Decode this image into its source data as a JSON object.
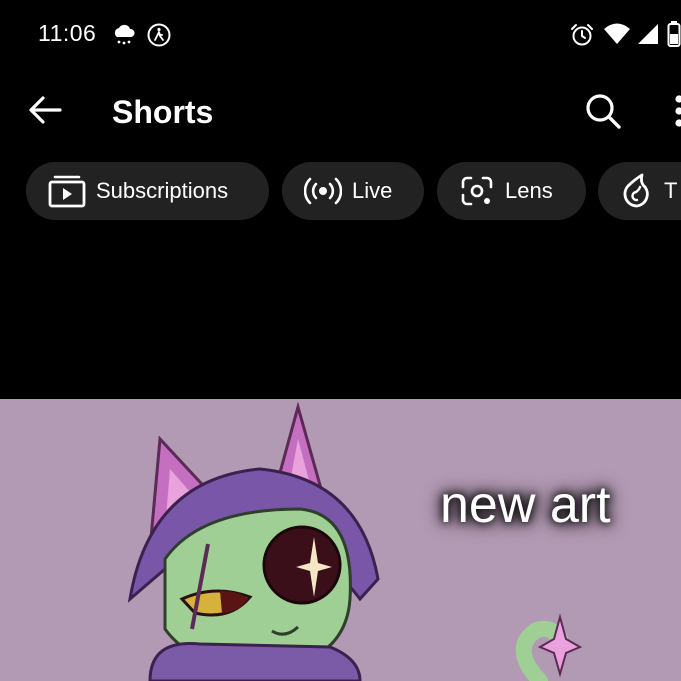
{
  "status_bar": {
    "time": "11:06",
    "left_icons": [
      "weather-rain-icon",
      "accessibility-icon"
    ],
    "right_icons": [
      "alarm-icon",
      "wifi-icon",
      "signal-icon",
      "battery-icon"
    ]
  },
  "app_bar": {
    "title": "Shorts",
    "back_icon": "arrow-left-icon",
    "actions": [
      "search-icon",
      "more-vert-icon"
    ]
  },
  "chips": [
    {
      "label": "Subscriptions",
      "icon": "subscriptions-icon"
    },
    {
      "label": "Live",
      "icon": "live-icon"
    },
    {
      "label": "Lens",
      "icon": "lens-icon"
    },
    {
      "label": "T",
      "icon": "trending-icon"
    }
  ],
  "video": {
    "overlay_text": "new art",
    "background_color": "#b39ab4"
  },
  "colors": {
    "background": "#000000",
    "chip_bg": "#222222",
    "text": "#ffffff"
  }
}
